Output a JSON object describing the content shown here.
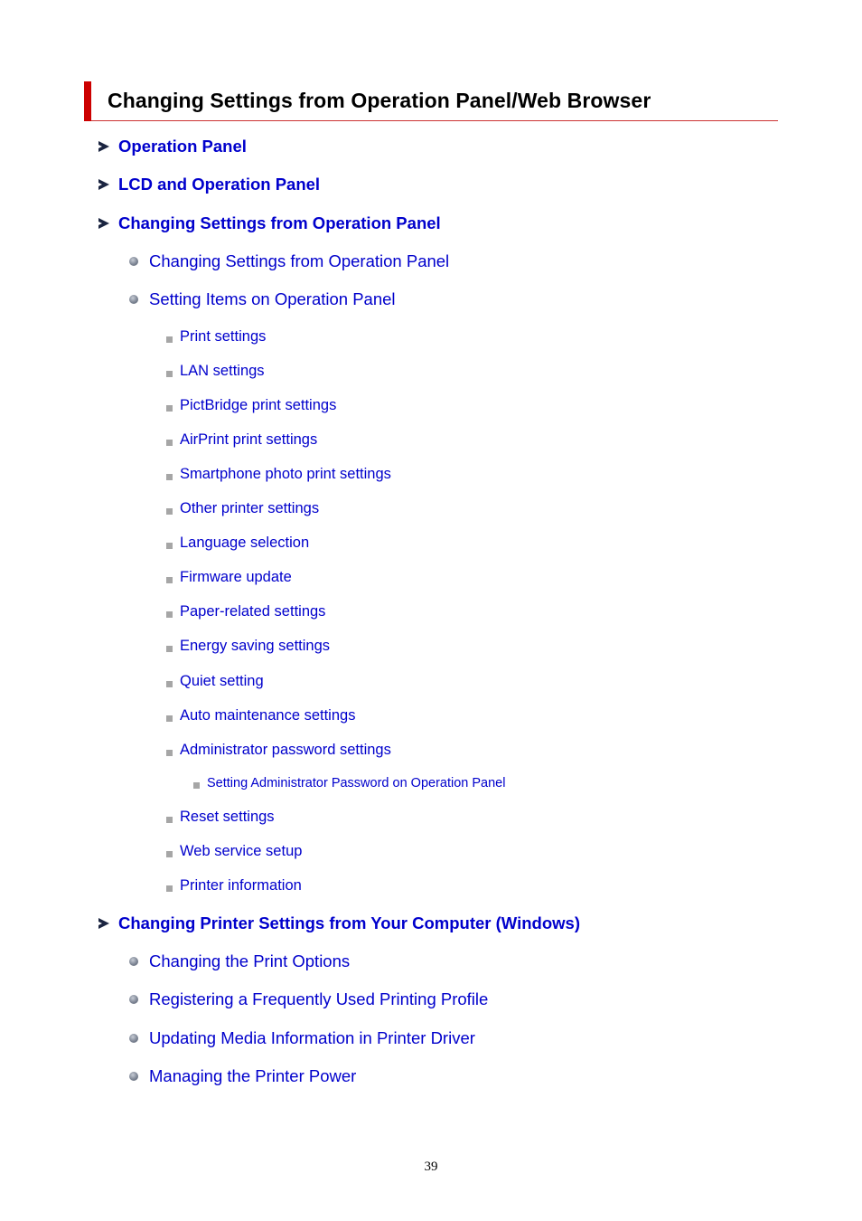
{
  "page": {
    "title": "Changing Settings from Operation Panel/Web Browser",
    "page_number": "39",
    "colors": {
      "link": "#0000cc",
      "title_bar": "#cc0000",
      "title_rule": "#cc3333"
    }
  },
  "toc": [
    {
      "level": 1,
      "icon": "arrow-icon",
      "label": "Operation Panel"
    },
    {
      "level": 1,
      "icon": "arrow-icon",
      "label": "LCD and Operation Panel"
    },
    {
      "level": 1,
      "icon": "arrow-icon",
      "label": "Changing Settings from Operation Panel"
    },
    {
      "level": 2,
      "icon": "bullet-icon",
      "label": "Changing Settings from Operation Panel"
    },
    {
      "level": 2,
      "icon": "bullet-icon",
      "label": "Setting Items on Operation Panel"
    },
    {
      "level": 3,
      "icon": "square-icon",
      "label": "Print settings"
    },
    {
      "level": 3,
      "icon": "square-icon",
      "label": "LAN settings"
    },
    {
      "level": 3,
      "icon": "square-icon",
      "label": "PictBridge print settings"
    },
    {
      "level": 3,
      "icon": "square-icon",
      "label": "AirPrint print settings"
    },
    {
      "level": 3,
      "icon": "square-icon",
      "label": "Smartphone photo print settings"
    },
    {
      "level": 3,
      "icon": "square-icon",
      "label": "Other printer settings"
    },
    {
      "level": 3,
      "icon": "square-icon",
      "label": "Language selection"
    },
    {
      "level": 3,
      "icon": "square-icon",
      "label": "Firmware update"
    },
    {
      "level": 3,
      "icon": "square-icon",
      "label": "Paper-related settings"
    },
    {
      "level": 3,
      "icon": "square-icon",
      "label": "Energy saving settings"
    },
    {
      "level": 3,
      "icon": "square-icon",
      "label": "Quiet setting"
    },
    {
      "level": 3,
      "icon": "square-icon",
      "label": "Auto maintenance settings"
    },
    {
      "level": 3,
      "icon": "square-icon",
      "label": "Administrator password settings"
    },
    {
      "level": 4,
      "icon": "square-icon",
      "label": "Setting Administrator Password on Operation Panel"
    },
    {
      "level": 3,
      "icon": "square-icon",
      "label": "Reset settings"
    },
    {
      "level": 3,
      "icon": "square-icon",
      "label": "Web service setup"
    },
    {
      "level": 3,
      "icon": "square-icon",
      "label": "Printer information"
    },
    {
      "level": 1,
      "icon": "arrow-icon",
      "label": "Changing Printer Settings from Your Computer (Windows)"
    },
    {
      "level": 2,
      "icon": "bullet-icon",
      "label": "Changing the Print Options"
    },
    {
      "level": 2,
      "icon": "bullet-icon",
      "label": "Registering a Frequently Used Printing Profile"
    },
    {
      "level": 2,
      "icon": "bullet-icon",
      "label": "Updating Media Information in Printer Driver"
    },
    {
      "level": 2,
      "icon": "bullet-icon",
      "label": "Managing the Printer Power"
    }
  ]
}
